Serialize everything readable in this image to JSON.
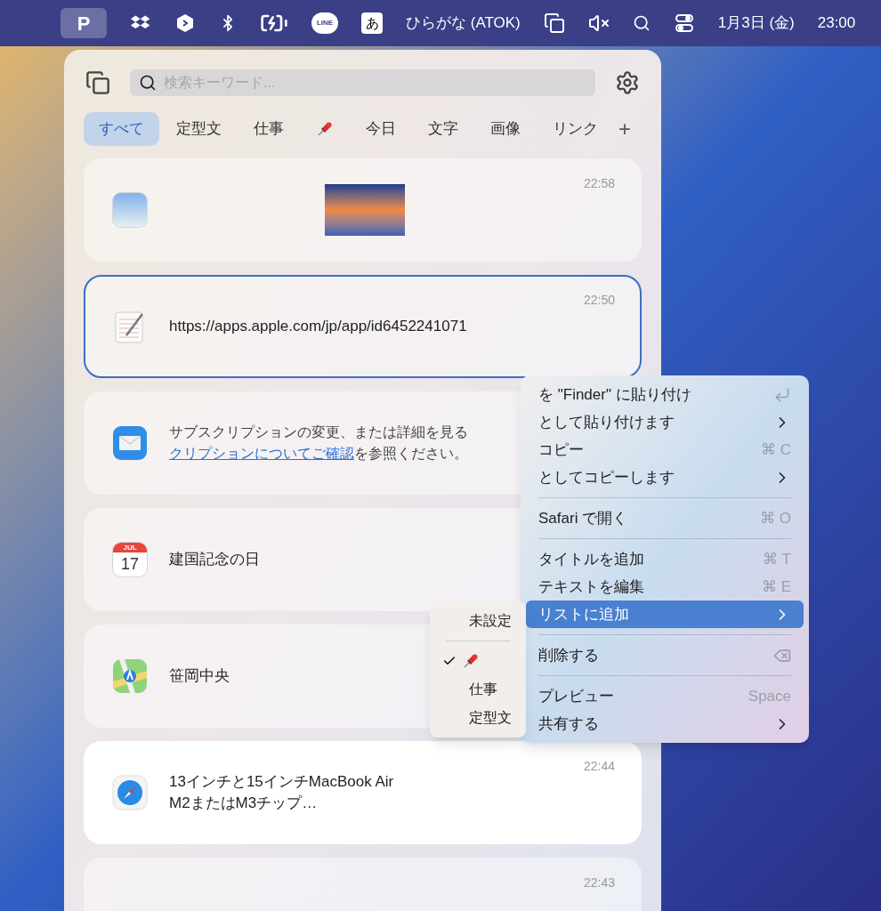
{
  "menu_bar": {
    "items": [
      {
        "kind": "app-letter",
        "text": "P",
        "selected": true
      },
      {
        "kind": "boxes"
      },
      {
        "kind": "hex"
      },
      {
        "kind": "bluetooth"
      },
      {
        "kind": "battery"
      },
      {
        "kind": "bubble",
        "text": "LINE"
      },
      {
        "kind": "input-box",
        "text": "あ"
      },
      {
        "kind": "label",
        "text": "ひらがな (ATOK)"
      },
      {
        "kind": "windows"
      },
      {
        "kind": "mute"
      },
      {
        "kind": "search"
      },
      {
        "kind": "toggles"
      },
      {
        "kind": "label",
        "text": "1月3日 (金)"
      },
      {
        "kind": "label",
        "text": "23:00"
      }
    ]
  },
  "panel": {
    "search": {
      "placeholder": "検索キーワード..."
    },
    "tabs": [
      {
        "kind": "text",
        "label": "すべて",
        "selected": true
      },
      {
        "kind": "text",
        "label": "定型文",
        "selected": false
      },
      {
        "kind": "text",
        "label": "仕事",
        "selected": false
      },
      {
        "kind": "pin",
        "selected": false
      },
      {
        "kind": "text",
        "label": "今日",
        "selected": false
      },
      {
        "kind": "text",
        "label": "文字",
        "selected": false
      },
      {
        "kind": "text",
        "label": "画像",
        "selected": false
      },
      {
        "kind": "text",
        "label": "リンク",
        "selected": false
      }
    ],
    "add_tab": "+",
    "cards": [
      {
        "kind": "preview",
        "thumbnail": true,
        "time": "22:58",
        "selected": false,
        "highlighted": false
      },
      {
        "kind": "textedit",
        "text": "https://apps.apple.com/jp/app/id6452241071",
        "time": "22:50",
        "selected": true,
        "highlighted": false
      },
      {
        "kind": "mail",
        "line_1": "サブスクリプションの変更、または詳細を見る",
        "link": "クリプションについてご確認",
        "rest": "を参照ください。",
        "selected": false,
        "highlighted": false
      },
      {
        "kind": "calendar",
        "calendar_month": "JUL",
        "calendar_day": "17",
        "text": "建国記念の日",
        "selected": false,
        "highlighted": false
      },
      {
        "kind": "maps",
        "text": "笹岡中央",
        "selected": false,
        "highlighted": false
      },
      {
        "kind": "safari",
        "text": "13インチと15インチMacBook Air\nM2またはM3チップ…",
        "time": "22:44",
        "selected": false,
        "highlighted": true
      },
      {
        "kind": "partial",
        "time": "22:43",
        "selected": false,
        "highlighted": false
      }
    ]
  },
  "context_menu": {
    "items": [
      {
        "kind": "item-return",
        "label": "を \"Finder\" に貼り付け",
        "submenu": false,
        "selected": false
      },
      {
        "kind": "item",
        "label": "として貼り付けます",
        "submenu": true,
        "selected": false
      },
      {
        "kind": "item",
        "label": "コピー",
        "shortcut": "⌘ C",
        "submenu": false,
        "selected": false
      },
      {
        "kind": "item",
        "label": "としてコピーします",
        "submenu": true,
        "selected": false
      },
      {
        "kind": "separator"
      },
      {
        "kind": "item",
        "label": "Safari で開く",
        "shortcut": "⌘ O",
        "submenu": false,
        "selected": false
      },
      {
        "kind": "separator"
      },
      {
        "kind": "item",
        "label": "タイトルを追加",
        "shortcut": "⌘ T",
        "submenu": false,
        "selected": false
      },
      {
        "kind": "item",
        "label": "テキストを編集",
        "shortcut": "⌘ E",
        "submenu": false,
        "selected": false
      },
      {
        "kind": "item",
        "label": "リストに追加",
        "submenu": true,
        "selected": true
      },
      {
        "kind": "separator"
      },
      {
        "kind": "item-delete",
        "label": "削除する",
        "submenu": false,
        "selected": false
      },
      {
        "kind": "separator"
      },
      {
        "kind": "item",
        "label": "プレビュー",
        "shortcut": "Space",
        "submenu": false,
        "selected": false
      },
      {
        "kind": "item",
        "label": "共有する",
        "submenu": true,
        "selected": false
      }
    ]
  },
  "submenu": {
    "items": [
      {
        "kind": "item",
        "label": "未設定",
        "checked": false
      },
      {
        "kind": "separator"
      },
      {
        "kind": "pin",
        "checked": true
      },
      {
        "kind": "item",
        "label": "仕事",
        "checked": false
      },
      {
        "kind": "item",
        "label": "定型文",
        "checked": false
      }
    ]
  }
}
